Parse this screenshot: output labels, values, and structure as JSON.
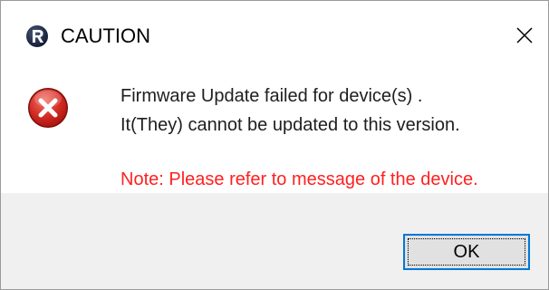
{
  "window": {
    "title": "CAUTION",
    "app_icon": "r-logo-icon",
    "close_icon": "close-icon"
  },
  "message": {
    "icon": "error-icon",
    "line1": "Firmware Update failed for device(s) .",
    "line2": "It(They) cannot be updated to this version.",
    "note": "Note: Please refer to message of the device."
  },
  "buttons": {
    "ok_label": "OK"
  },
  "colors": {
    "error_red": "#d32f2f",
    "note_red": "#ff2020",
    "focus_blue": "#0078d7"
  }
}
